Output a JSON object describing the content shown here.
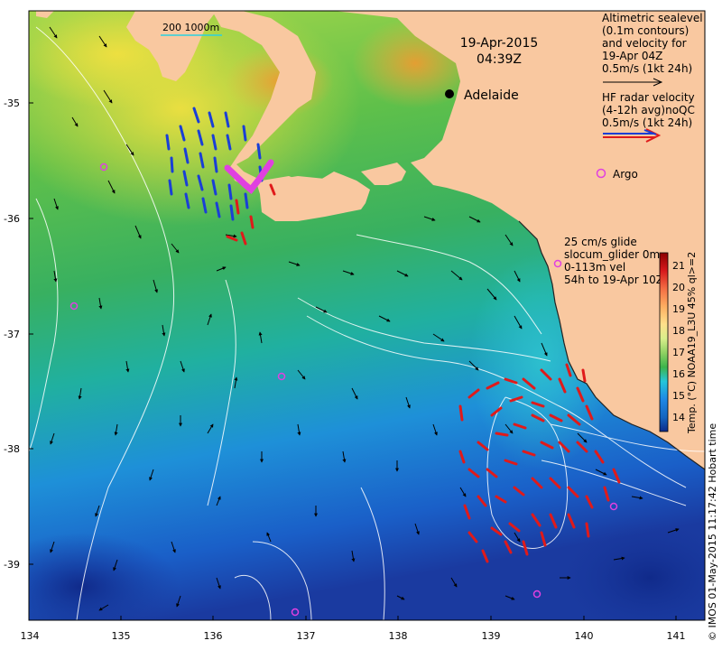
{
  "map": {
    "date": "19-Apr-2015",
    "time": "04:39Z",
    "lon_ticks": [
      "134",
      "135",
      "136",
      "137",
      "138",
      "139",
      "140",
      "141"
    ],
    "lat_ticks": [
      "-35",
      "-36",
      "-37",
      "-38",
      "-39"
    ],
    "scale_bar_label": "200  1000m"
  },
  "places": {
    "adelaide": "Adelaide",
    "argo": "Argo"
  },
  "legend": {
    "altimetry_lines": [
      "Altimetric sealevel",
      "(0.1m contours)",
      "and velocity for",
      "19-Apr 04Z",
      "0.5m/s (1kt 24h)"
    ],
    "hf_radar_lines": [
      "HF radar velocity",
      "(4-12h avg)noQC",
      "0.5m/s (1kt 24h)"
    ],
    "glider_lines": [
      "25 cm/s glide",
      "slocum_glider 0m",
      "0-113m vel",
      "54h to 19-Apr 10Z"
    ]
  },
  "colorbar": {
    "ticks": [
      "21",
      "20",
      "19",
      "18",
      "17",
      "16",
      "15",
      "14"
    ],
    "label": "Temp. (°C) NOAA19_L3U 45% ql>=2",
    "colors": [
      "#8b0000",
      "#d7191c",
      "#f46d43",
      "#fdae61",
      "#fee08b",
      "#d9ef8b",
      "#a6d96a",
      "#66bd63",
      "#1a9850",
      "#26c6da",
      "#1e88e5",
      "#1565c0",
      "#0d2a8a"
    ]
  },
  "credit": "© IMOS 01-May-2015 11:17:42 Hobart time",
  "colors": {
    "land": "#f9c8a0",
    "hf_radar_blue": "#1a3fd6",
    "hf_radar_red": "#e01a1a",
    "argo": "#e040e0",
    "glider_track": "#e040e0"
  }
}
